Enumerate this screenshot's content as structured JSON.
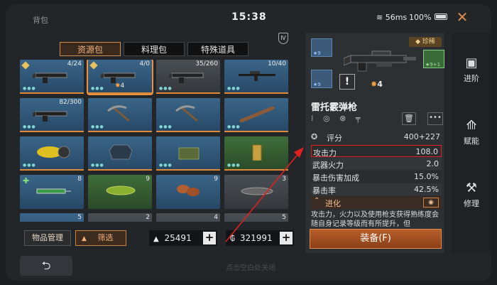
{
  "header": {
    "title": "背包",
    "time": "15:38",
    "ping": "56ms",
    "battery": "100%"
  },
  "tabs": [
    "资源包",
    "料理包",
    "特殊道具"
  ],
  "grid": [
    {
      "count": "4/24",
      "color": "blue",
      "kind": "gun",
      "diamond": true
    },
    {
      "count": "4/0",
      "color": "blue",
      "kind": "gun",
      "selected": true,
      "diamond": true,
      "star": "4"
    },
    {
      "count": "35/260",
      "color": "gray",
      "kind": "gun"
    },
    {
      "count": "10/40",
      "color": "blue",
      "kind": "rifle"
    },
    {
      "count": "82/300",
      "color": "blue",
      "kind": "gun"
    },
    {
      "count": "",
      "color": "blue",
      "kind": "pickaxe"
    },
    {
      "count": "",
      "color": "blue",
      "kind": "pickaxe"
    },
    {
      "count": "",
      "color": "blue",
      "kind": "bat"
    },
    {
      "count": "",
      "color": "blue",
      "kind": "drill"
    },
    {
      "count": "",
      "color": "blue",
      "kind": "armor"
    },
    {
      "count": "",
      "color": "blue",
      "kind": "crate"
    },
    {
      "count": "",
      "color": "green",
      "kind": "tower"
    },
    {
      "count": "8",
      "color": "blue",
      "kind": "syringe",
      "plus": true
    },
    {
      "count": "9",
      "color": "green",
      "kind": "fish"
    },
    {
      "count": "9",
      "color": "blue",
      "kind": "mushroom"
    },
    {
      "count": "3",
      "color": "gray",
      "kind": "catfish"
    },
    {
      "count": "5",
      "color": "blue",
      "kind": ""
    },
    {
      "count": "2",
      "color": "gray",
      "kind": ""
    },
    {
      "count": "4",
      "color": "gray",
      "kind": ""
    },
    {
      "count": "5",
      "color": "gray",
      "kind": ""
    }
  ],
  "bottom": {
    "manage": "物品管理",
    "filter": "筛选",
    "currency1": "25491",
    "currency2": "321991",
    "hint": "点击空白处关闭"
  },
  "detail": {
    "rarity": "珍稀",
    "attach_levels": [
      "★9",
      "★9",
      "★9+1"
    ],
    "star_count": "4",
    "name": "雷托霰弹枪",
    "rating_label": "评分",
    "rating_value": "400+227",
    "stats": [
      {
        "label": "攻击力",
        "value": "108.0"
      },
      {
        "label": "武器火力",
        "value": "2.0"
      },
      {
        "label": "暴击伤害加成",
        "value": "15.0%"
      },
      {
        "label": "暴击率",
        "value": "42.5%"
      }
    ],
    "evolve": "进化",
    "description": "攻击力，火力以及使用枪支获得熟练度会随自身记录等级而有所提升，但",
    "equip": "装备(F)"
  },
  "sidebar": [
    "进阶",
    "赋能",
    "修理"
  ]
}
